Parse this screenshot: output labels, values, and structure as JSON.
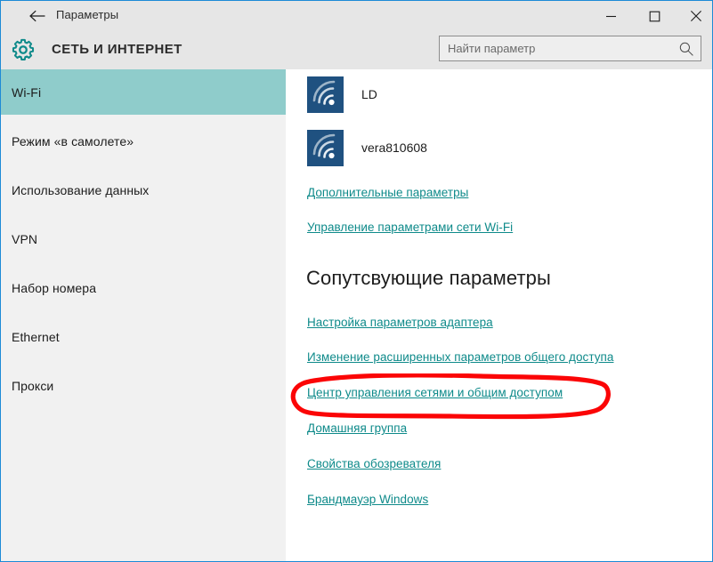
{
  "window": {
    "title": "Параметры",
    "back_icon": "back-arrow-icon",
    "controls": {
      "minimize": "─",
      "maximize": "□",
      "close": "✕"
    },
    "border_color": "#1d8ad6"
  },
  "header": {
    "gear_icon": "gear-icon",
    "category": "СЕТЬ И ИНТЕРНЕТ",
    "accent_color": "#0e8a8a"
  },
  "search": {
    "placeholder": "Найти параметр",
    "value": "",
    "icon": "search-icon"
  },
  "sidebar": {
    "background": "#f1f1f1",
    "selected_color": "#8fcccb",
    "items": [
      {
        "label": "Wi-Fi",
        "selected": true
      },
      {
        "label": "Режим «в самолете»",
        "selected": false
      },
      {
        "label": "Использование данных",
        "selected": false
      },
      {
        "label": "VPN",
        "selected": false
      },
      {
        "label": "Набор номера",
        "selected": false
      },
      {
        "label": "Ethernet",
        "selected": false
      },
      {
        "label": "Прокси",
        "selected": false
      }
    ]
  },
  "content": {
    "networks": [
      {
        "name": "LD",
        "icon": "wifi-signal-icon",
        "tile_color": "#1f5180"
      },
      {
        "name": "vera810608",
        "icon": "wifi-signal-icon",
        "tile_color": "#1f5180"
      }
    ],
    "top_links": [
      {
        "label": "Дополнительные параметры"
      },
      {
        "label": "Управление параметрами сети Wi-Fi"
      }
    ],
    "related_heading": "Сопутсвующие параметры",
    "related_links": [
      {
        "label": "Настройка параметров адаптера",
        "highlighted": false
      },
      {
        "label": "Изменение расширенных параметров общего доступа",
        "highlighted": false
      },
      {
        "label": "Центр управления сетями и общим доступом",
        "highlighted": true
      },
      {
        "label": "Домашняя группа",
        "highlighted": false
      },
      {
        "label": "Свойства обозревателя",
        "highlighted": false
      },
      {
        "label": "Брандмауэр Windows",
        "highlighted": false
      }
    ]
  },
  "annotation": {
    "shape": "red-ellipse",
    "color": "#fb0506",
    "targets": "Центр управления сетями и общим доступом"
  }
}
